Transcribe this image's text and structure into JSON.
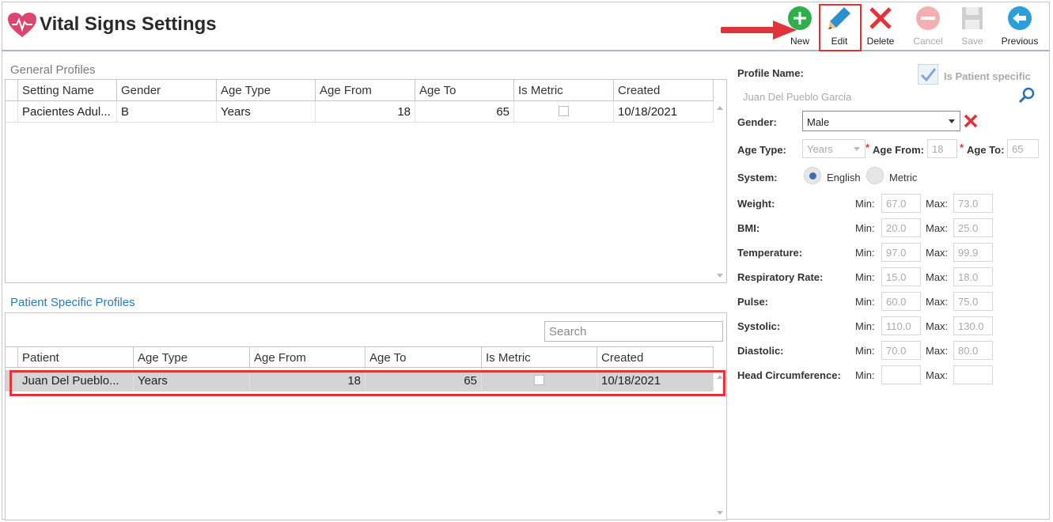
{
  "header": {
    "title": "Vital Signs Settings",
    "toolbar": {
      "new_label": "New",
      "edit_label": "Edit",
      "delete_label": "Delete",
      "cancel_label": "Cancel",
      "save_label": "Save",
      "previous_label": "Previous"
    }
  },
  "general_profiles": {
    "title": "General Profiles",
    "columns": [
      "Setting Name",
      "Gender",
      "Age Type",
      "Age From",
      "Age To",
      "Is Metric",
      "Created"
    ],
    "rows": [
      {
        "setting_name": "Pacientes Adul...",
        "gender": "B",
        "age_type": "Years",
        "age_from": "18",
        "age_to": "65",
        "is_metric": false,
        "created": "10/18/2021"
      }
    ]
  },
  "patient_profiles": {
    "title": "Patient Specific Profiles",
    "search_placeholder": "Search",
    "columns": [
      "Patient",
      "Age Type",
      "Age From",
      "Age To",
      "Is Metric",
      "Created"
    ],
    "rows": [
      {
        "patient": "Juan Del Pueblo...",
        "age_type": "Years",
        "age_from": "18",
        "age_to": "65",
        "is_metric": false,
        "created": "10/18/2021"
      }
    ]
  },
  "form": {
    "profile_name_label": "Profile Name:",
    "profile_name_value": "Juan Del Pueblo Garcia",
    "patient_specific_label": "Is Patient specific",
    "gender_label": "Gender:",
    "gender_value": "Male",
    "age_type_label": "Age Type:",
    "age_type_value": "Years",
    "age_from_label": "Age From:",
    "age_from_value": "18",
    "age_to_label": "Age To:",
    "age_to_value": "65",
    "system_label": "System:",
    "system_english": "English",
    "system_metric": "Metric",
    "min_label": "Min:",
    "max_label": "Max:",
    "vitals": [
      {
        "label": "Weight:",
        "min": "67.0",
        "max": "73.0"
      },
      {
        "label": "BMI:",
        "min": "20.0",
        "max": "25.0"
      },
      {
        "label": "Temperature:",
        "min": "97.0",
        "max": "99.9"
      },
      {
        "label": "Respiratory Rate:",
        "min": "15.0",
        "max": "18.0"
      },
      {
        "label": "Pulse:",
        "min": "60.0",
        "max": "75.0"
      },
      {
        "label": "Systolic:",
        "min": "110.0",
        "max": "130.0"
      },
      {
        "label": "Diastolic:",
        "min": "70.0",
        "max": "80.0"
      },
      {
        "label": "Head Circumference:",
        "min": "",
        "max": ""
      }
    ]
  },
  "colors": {
    "accent_red": "#e0333a",
    "link_blue": "#2a7ab8",
    "new_green": "#2fae4e",
    "previous_teal": "#2b9fd6"
  }
}
